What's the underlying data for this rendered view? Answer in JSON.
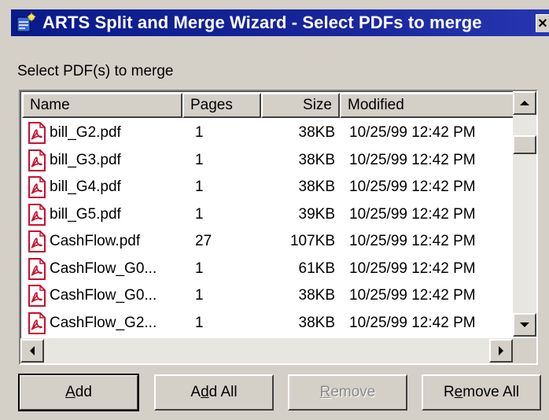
{
  "window": {
    "title": "ARTS Split and Merge Wizard - Select PDFs to merge",
    "close_glyph": "✕"
  },
  "section_label": "Select PDF(s) to merge",
  "columns": [
    "Name",
    "Pages",
    "Size",
    "Modified"
  ],
  "files": [
    {
      "name": "bill_G2.pdf",
      "pages": "1",
      "size": "38KB",
      "modified": "10/25/99 12:42 PM"
    },
    {
      "name": "bill_G3.pdf",
      "pages": "1",
      "size": "38KB",
      "modified": "10/25/99 12:42 PM"
    },
    {
      "name": "bill_G4.pdf",
      "pages": "1",
      "size": "38KB",
      "modified": "10/25/99 12:42 PM"
    },
    {
      "name": "bill_G5.pdf",
      "pages": "1",
      "size": "39KB",
      "modified": "10/25/99 12:42 PM"
    },
    {
      "name": "CashFlow.pdf",
      "pages": "27",
      "size": "107KB",
      "modified": "10/25/99 12:42 PM"
    },
    {
      "name": "CashFlow_G0...",
      "pages": "1",
      "size": "61KB",
      "modified": "10/25/99 12:42 PM"
    },
    {
      "name": "CashFlow_G0...",
      "pages": "1",
      "size": "38KB",
      "modified": "10/25/99 12:42 PM"
    },
    {
      "name": "CashFlow_G2...",
      "pages": "1",
      "size": "38KB",
      "modified": "10/25/99 12:42 PM"
    }
  ],
  "buttons": {
    "add": {
      "pre": "",
      "key": "A",
      "post": "dd",
      "enabled": true
    },
    "add_all": {
      "pre": "A",
      "key": "d",
      "post": "d All",
      "enabled": true
    },
    "remove": {
      "pre": "",
      "key": "R",
      "post": "emove",
      "enabled": false
    },
    "remove_all": {
      "pre": "R",
      "key": "e",
      "post": "move All",
      "enabled": true
    }
  },
  "colors": {
    "title_bar": "#0a1a8a",
    "dialog_bg": "#d4d0c8",
    "pdf_icon": "#c8102e"
  },
  "icons": {
    "app": "arts-wizard-icon",
    "file": "pdf-file-icon"
  }
}
